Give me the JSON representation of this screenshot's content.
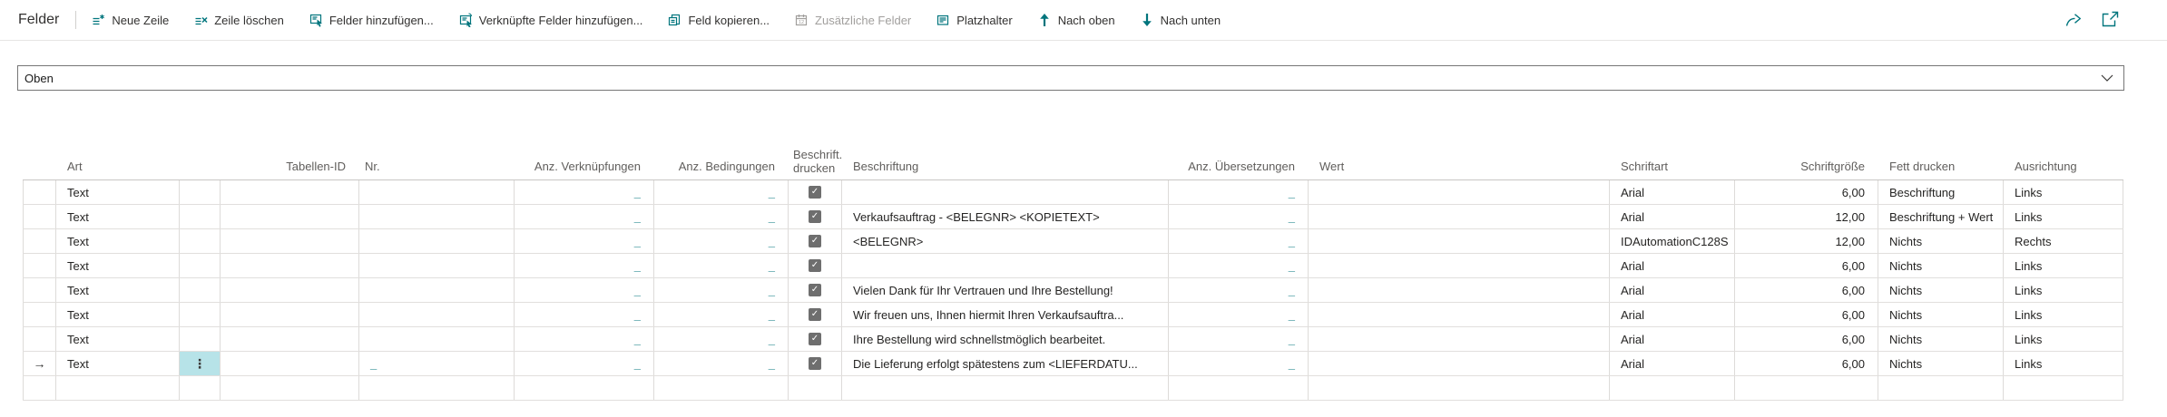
{
  "app": {
    "caption": "Felder"
  },
  "toolbar": {
    "buttons": [
      {
        "label": "Neue Zeile",
        "disabled": false
      },
      {
        "label": "Zeile löschen",
        "disabled": false
      },
      {
        "label": "Felder hinzufügen...",
        "disabled": false
      },
      {
        "label": "Verknüpfte Felder hinzufügen...",
        "disabled": false
      },
      {
        "label": "Feld kopieren...",
        "disabled": false
      },
      {
        "label": "Zusätzliche Felder",
        "disabled": true
      },
      {
        "label": "Platzhalter",
        "disabled": false
      },
      {
        "label": "Nach oben",
        "disabled": false
      },
      {
        "label": "Nach unten",
        "disabled": false
      }
    ]
  },
  "section_dropdown": {
    "value": "Oben"
  },
  "icons": {
    "ellipsis": "⋮"
  },
  "table": {
    "current_row_marker": "→",
    "columns": {
      "art": "Art",
      "tabellen_id": "Tabellen-ID",
      "nr": "Nr.",
      "anz_verknuepfungen": "Anz. Verknüpfungen",
      "anz_bedingungen": "Anz. Bedingungen",
      "beschrift_drucken_line1": "Beschrift...",
      "beschrift_drucken_line2": "drucken",
      "beschriftung": "Beschriftung",
      "anz_uebersetzungen": "Anz. Übersetzungen",
      "wert": "Wert",
      "schriftart": "Schriftart",
      "schriftgroesse": "Schriftgröße",
      "fett_drucken": "Fett drucken",
      "ausrichtung": "Ausrichtung"
    },
    "rows": [
      {
        "art": "Text",
        "tabellen_id": "",
        "nr": "",
        "anz_verknuepfungen": "_",
        "anz_bedingungen": "_",
        "beschriftung_drucken": true,
        "beschriftung": "",
        "anz_uebersetzungen": "_",
        "wert": "",
        "schriftart": "Arial",
        "schriftgroesse": "6,00",
        "fett_drucken": "Beschriftung",
        "ausrichtung": "Links"
      },
      {
        "art": "Text",
        "tabellen_id": "",
        "nr": "",
        "anz_verknuepfungen": "_",
        "anz_bedingungen": "_",
        "beschriftung_drucken": true,
        "beschriftung": "Verkaufsauftrag - <BELEGNR> <KOPIETEXT>",
        "anz_uebersetzungen": "_",
        "wert": "",
        "schriftart": "Arial",
        "schriftgroesse": "12,00",
        "fett_drucken": "Beschriftung + Wert",
        "ausrichtung": "Links"
      },
      {
        "art": "Text",
        "tabellen_id": "",
        "nr": "",
        "anz_verknuepfungen": "_",
        "anz_bedingungen": "_",
        "beschriftung_drucken": true,
        "beschriftung": "<BELEGNR>",
        "anz_uebersetzungen": "_",
        "wert": "",
        "schriftart": "IDAutomationC128S",
        "schriftgroesse": "12,00",
        "fett_drucken": "Nichts",
        "ausrichtung": "Rechts"
      },
      {
        "art": "Text",
        "tabellen_id": "",
        "nr": "",
        "anz_verknuepfungen": "_",
        "anz_bedingungen": "_",
        "beschriftung_drucken": true,
        "beschriftung": "",
        "anz_uebersetzungen": "_",
        "wert": "",
        "schriftart": "Arial",
        "schriftgroesse": "6,00",
        "fett_drucken": "Nichts",
        "ausrichtung": "Links"
      },
      {
        "art": "Text",
        "tabellen_id": "",
        "nr": "",
        "anz_verknuepfungen": "_",
        "anz_bedingungen": "_",
        "beschriftung_drucken": true,
        "beschriftung": "Vielen Dank für Ihr Vertrauen und Ihre Bestellung!",
        "anz_uebersetzungen": "_",
        "wert": "",
        "schriftart": "Arial",
        "schriftgroesse": "6,00",
        "fett_drucken": "Nichts",
        "ausrichtung": "Links"
      },
      {
        "art": "Text",
        "tabellen_id": "",
        "nr": "",
        "anz_verknuepfungen": "_",
        "anz_bedingungen": "_",
        "beschriftung_drucken": true,
        "beschriftung": "Wir freuen uns, Ihnen hiermit Ihren Verkaufsauftra...",
        "anz_uebersetzungen": "_",
        "wert": "",
        "schriftart": "Arial",
        "schriftgroesse": "6,00",
        "fett_drucken": "Nichts",
        "ausrichtung": "Links"
      },
      {
        "art": "Text",
        "tabellen_id": "",
        "nr": "",
        "anz_verknuepfungen": "_",
        "anz_bedingungen": "_",
        "beschriftung_drucken": true,
        "beschriftung": "Ihre Bestellung wird schnellstmöglich bearbeitet.",
        "anz_uebersetzungen": "_",
        "wert": "",
        "schriftart": "Arial",
        "schriftgroesse": "6,00",
        "fett_drucken": "Nichts",
        "ausrichtung": "Links"
      },
      {
        "art": "Text",
        "selected": true,
        "tabellen_id": "",
        "nr": "_",
        "anz_verknuepfungen": "_",
        "anz_bedingungen": "_",
        "beschriftung_drucken": true,
        "beschriftung": "Die Lieferung erfolgt spätestens zum <LIEFERDATU...",
        "anz_uebersetzungen": "_",
        "wert": "",
        "schriftart": "Arial",
        "schriftgroesse": "6,00",
        "fett_drucken": "Nichts",
        "ausrichtung": "Links"
      },
      {
        "art": "",
        "tabellen_id": "",
        "nr": "",
        "anz_verknuepfungen": "",
        "anz_bedingungen": "",
        "beschriftung_drucken": false,
        "beschriftung": "",
        "anz_uebersetzungen": "",
        "wert": "",
        "schriftart": "",
        "schriftgroesse": "",
        "fett_drucken": "",
        "ausrichtung": ""
      }
    ]
  },
  "colors": {
    "accent": "#00757d",
    "link": "#00757d",
    "active_cell_highlight": "#b7e3e8",
    "disabled": "#a19f9d"
  }
}
